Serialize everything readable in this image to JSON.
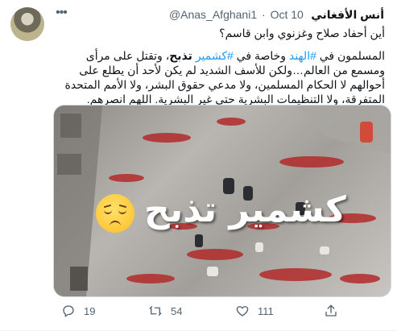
{
  "author": {
    "display_name": "أنس الأفغاني",
    "handle": "@Anas_Afghani1",
    "separator": "·",
    "date": "Oct 10"
  },
  "tweet": {
    "line1": "أين أحفاد صلاح وغزنوي وابن قاسم؟",
    "p_before_tag1": "المسلمون في ",
    "tag1": "#الهند",
    "p_between": " وخاصة في ",
    "tag2": "#كشمير",
    "bold_word": " تذبح",
    "p_after": "، وتقتل على مرأى ومسمع من العالم…ولكن للأسف الشديد لم يكن لأحد أن يطلع على أحوالهم لا الحكام المسلمين، ولا مدعي حقوق البشر، ولا الأمم المتحدة المتفرقة، ولا التنظيمات البشرية حتى غير البشرية. اللهم انصرهم."
  },
  "media": {
    "overlay_text": "كشمير تذبح",
    "emoji": "pensive-face"
  },
  "actions": {
    "reply_count": "19",
    "retweet_count": "54",
    "like_count": "111"
  },
  "colors": {
    "link": "#1d9bf0",
    "secondary_text": "#536471",
    "blood": "#b22a2a"
  },
  "icons": [
    "more-icon",
    "reply-icon",
    "retweet-icon",
    "like-icon",
    "share-icon"
  ]
}
